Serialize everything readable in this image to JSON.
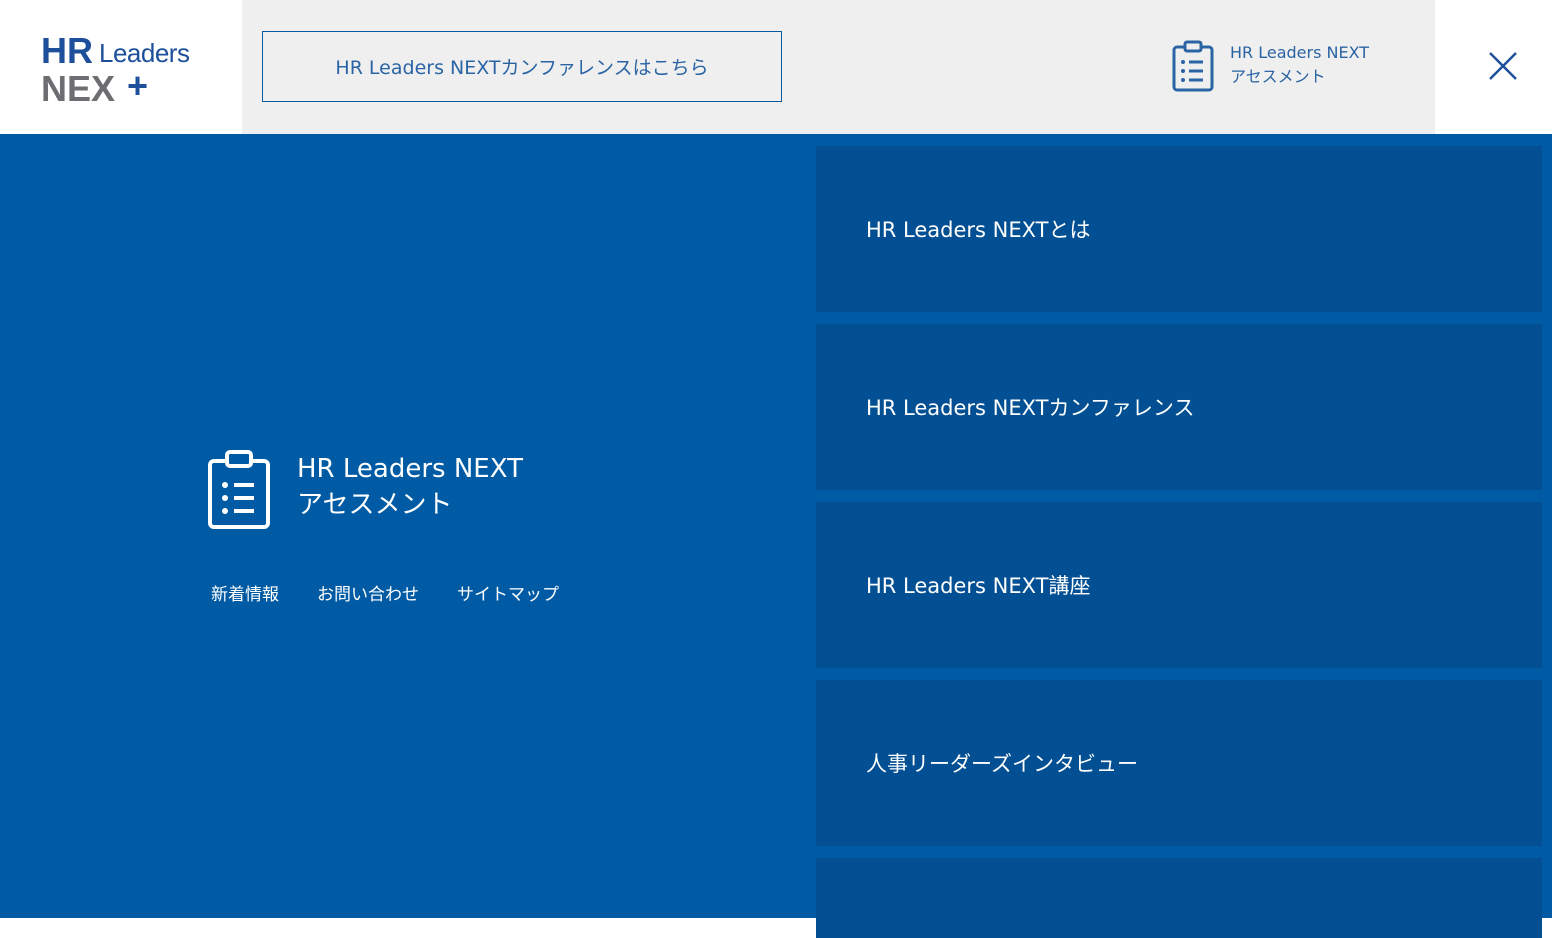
{
  "header": {
    "logo": {
      "line1_bold": "HR",
      "line1_light": "Leaders",
      "line2": "NEX",
      "plus": "+"
    },
    "conference_button_label": "HR Leaders NEXTカンファレンスはこちら",
    "assessment_link": {
      "line1": "HR Leaders NEXT",
      "line2": "アセスメント"
    },
    "colors": {
      "band_background": "#efefef",
      "accent": "#2a64a4",
      "logo_blue": "#1d4f9a",
      "logo_gray": "#6d6e71"
    }
  },
  "left_panel": {
    "assessment_link": {
      "line1": "HR Leaders NEXT",
      "line2": "アセスメント"
    },
    "footer_links": [
      "新着情報",
      "お問い合わせ",
      "サイトマップ"
    ]
  },
  "menu": {
    "items": [
      "HR Leaders NEXTとは",
      "HR Leaders NEXTカンファレンス",
      "HR Leaders NEXT講座",
      "人事リーダーズインタビュー",
      ""
    ]
  },
  "colors": {
    "main_background": "#005ba4",
    "menu_item_background": "#024f93"
  },
  "icons": {
    "clipboard": "clipboard-list-icon",
    "close": "close-icon"
  }
}
